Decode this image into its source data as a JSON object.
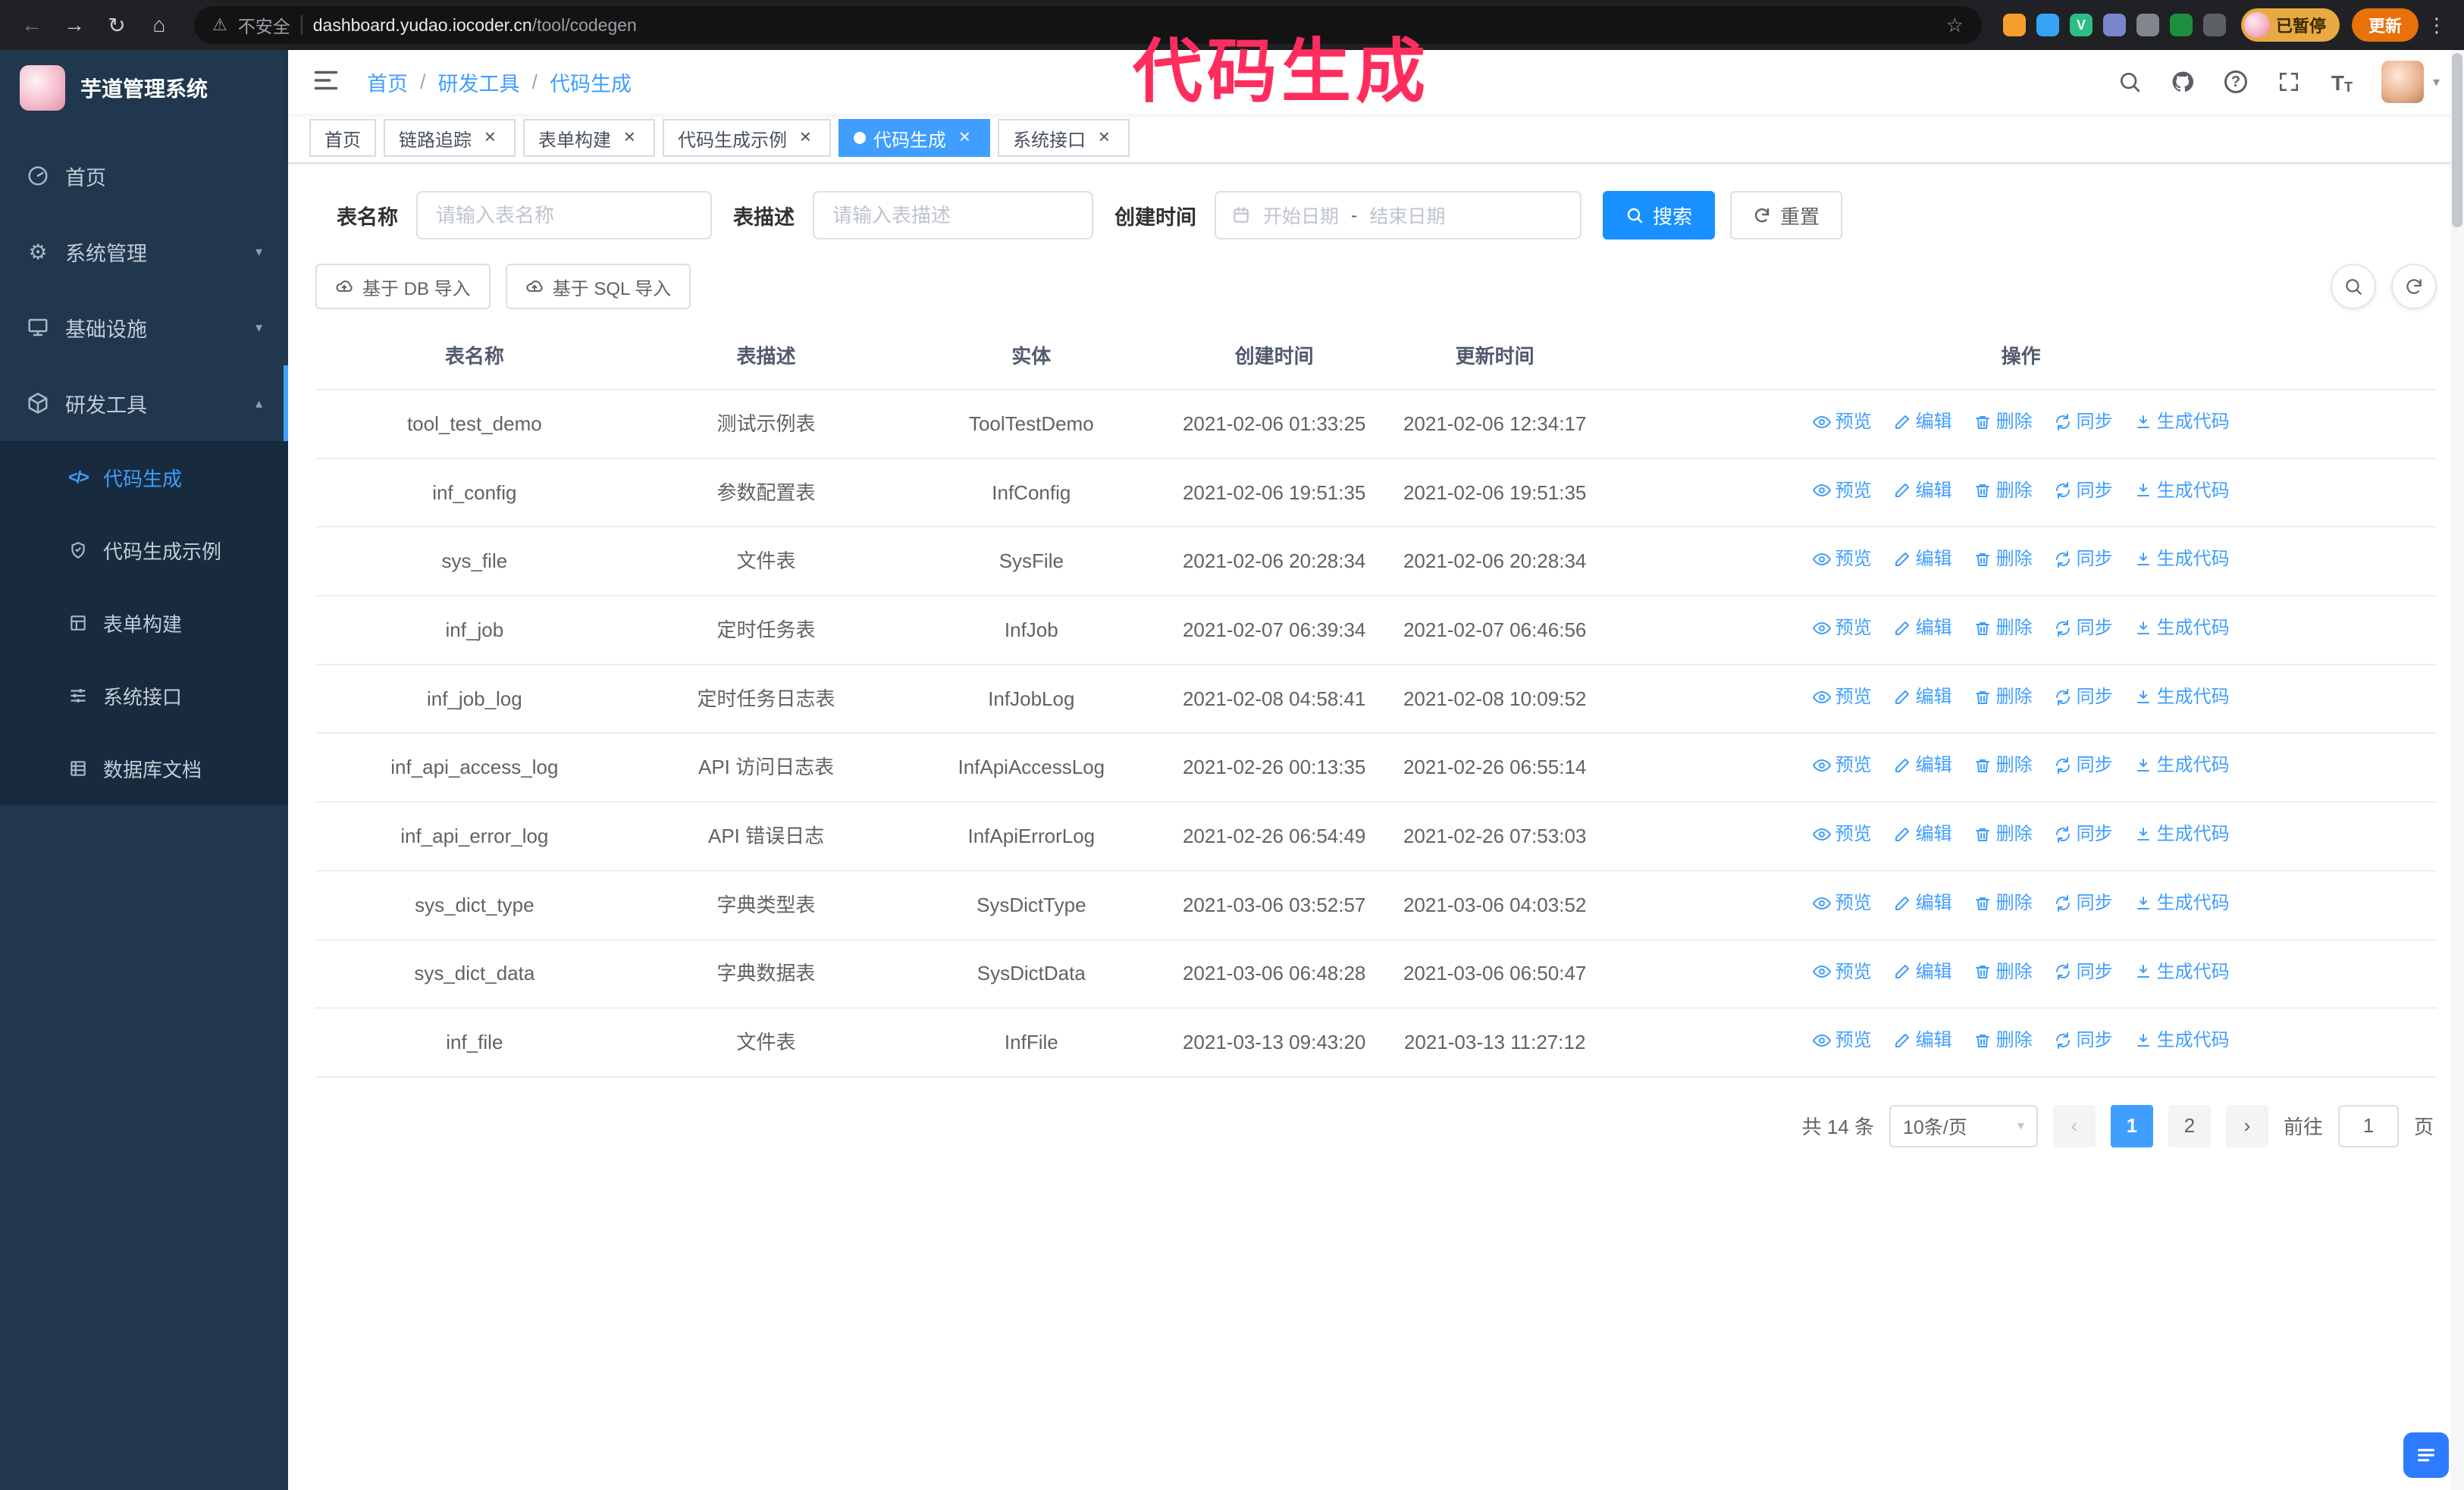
{
  "colors": {
    "accent": "#409eff",
    "btn_primary": "#1890ff",
    "annotation": "#ff2d5e",
    "sidebar_bg": "#20374e",
    "sidebar_sub": "#182b3e",
    "update": "#e8710a",
    "paused": "#e9a941"
  },
  "annotation": {
    "text": "代码生成"
  },
  "browser": {
    "security_label": "不安全",
    "url_host": "dashboard.yudao.iocoder.cn",
    "url_path": "/tool/codegen",
    "paused_badge": "已暂停",
    "update_button": "更新",
    "extensions": [
      {
        "name": "extension-icon-orange",
        "color": "#f59e2c"
      },
      {
        "name": "extension-icon-lightblue",
        "color": "#36a3f5"
      },
      {
        "name": "extension-icon-vue",
        "color": "#2ebd85",
        "glyph": "V"
      },
      {
        "name": "extension-icon-people",
        "color": "#7986cb"
      },
      {
        "name": "extension-icon-gray",
        "color": "#80868b"
      },
      {
        "name": "extension-icon-green",
        "color": "#1e8e3e"
      },
      {
        "name": "extensions-puzzle",
        "color": "#5c6064"
      }
    ]
  },
  "sidebar": {
    "logo_title": "芋道管理系统",
    "items": [
      {
        "id": "home",
        "label": "首页"
      },
      {
        "id": "system",
        "label": "系统管理"
      },
      {
        "id": "infra",
        "label": "基础设施"
      },
      {
        "id": "devtools",
        "label": "研发工具"
      }
    ],
    "subitems": [
      {
        "id": "codegen",
        "label": "代码生成",
        "active": true
      },
      {
        "id": "codegen-demo",
        "label": "代码生成示例"
      },
      {
        "id": "form-builder",
        "label": "表单构建"
      },
      {
        "id": "api",
        "label": "系统接口"
      },
      {
        "id": "db-doc",
        "label": "数据库文档"
      }
    ]
  },
  "header": {
    "breadcrumb": [
      "首页",
      "研发工具",
      "代码生成"
    ],
    "breadcrumb_separator": "/"
  },
  "tabs": [
    {
      "id": "home",
      "label": "首页",
      "closable": false,
      "active": false
    },
    {
      "id": "tracing",
      "label": "链路追踪",
      "closable": true,
      "active": false
    },
    {
      "id": "form-builder",
      "label": "表单构建",
      "closable": true,
      "active": false
    },
    {
      "id": "codegen-demo",
      "label": "代码生成示例",
      "closable": true,
      "active": false
    },
    {
      "id": "codegen",
      "label": "代码生成",
      "closable": true,
      "active": true
    },
    {
      "id": "api",
      "label": "系统接口",
      "closable": true,
      "active": false
    }
  ],
  "filters": {
    "table_name_label": "表名称",
    "table_name_placeholder": "请输入表名称",
    "table_desc_label": "表描述",
    "table_desc_placeholder": "请输入表描述",
    "create_time_label": "创建时间",
    "date_start_placeholder": "开始日期",
    "date_separator": "-",
    "date_end_placeholder": "结束日期",
    "search_button": "搜索",
    "reset_button": "重置"
  },
  "toolbar": {
    "import_db": "基于 DB 导入",
    "import_sql": "基于 SQL 导入"
  },
  "table": {
    "columns": [
      "表名称",
      "表描述",
      "实体",
      "创建时间",
      "更新时间",
      "操作"
    ],
    "action_labels": [
      "预览",
      "编辑",
      "删除",
      "同步",
      "生成代码"
    ],
    "rows": [
      {
        "name": "tool_test_demo",
        "desc": "测试示例表",
        "entity": "ToolTestDemo",
        "created": "2021-02-06 01:33:25",
        "updated": "2021-02-06 12:34:17"
      },
      {
        "name": "inf_config",
        "desc": "参数配置表",
        "entity": "InfConfig",
        "created": "2021-02-06 19:51:35",
        "updated": "2021-02-06 19:51:35"
      },
      {
        "name": "sys_file",
        "desc": "文件表",
        "entity": "SysFile",
        "created": "2021-02-06 20:28:34",
        "updated": "2021-02-06 20:28:34"
      },
      {
        "name": "inf_job",
        "desc": "定时任务表",
        "entity": "InfJob",
        "created": "2021-02-07 06:39:34",
        "updated": "2021-02-07 06:46:56"
      },
      {
        "name": "inf_job_log",
        "desc": "定时任务日志表",
        "entity": "InfJobLog",
        "created": "2021-02-08 04:58:41",
        "updated": "2021-02-08 10:09:52"
      },
      {
        "name": "inf_api_access_log",
        "desc": "API 访问日志表",
        "entity": "InfApiAccessLog",
        "created": "2021-02-26 00:13:35",
        "updated": "2021-02-26 06:55:14"
      },
      {
        "name": "inf_api_error_log",
        "desc": "API 错误日志",
        "entity": "InfApiErrorLog",
        "created": "2021-02-26 06:54:49",
        "updated": "2021-02-26 07:53:03"
      },
      {
        "name": "sys_dict_type",
        "desc": "字典类型表",
        "entity": "SysDictType",
        "created": "2021-03-06 03:52:57",
        "updated": "2021-03-06 04:03:52"
      },
      {
        "name": "sys_dict_data",
        "desc": "字典数据表",
        "entity": "SysDictData",
        "created": "2021-03-06 06:48:28",
        "updated": "2021-03-06 06:50:47"
      },
      {
        "name": "inf_file",
        "desc": "文件表",
        "entity": "InfFile",
        "created": "2021-03-13 09:43:20",
        "updated": "2021-03-13 11:27:12"
      }
    ]
  },
  "pagination": {
    "total": "共 14 条",
    "page_size": "10条/页",
    "pages": [
      "1",
      "2"
    ],
    "goto_label": "前往",
    "goto_value": "1",
    "goto_unit": "页"
  }
}
